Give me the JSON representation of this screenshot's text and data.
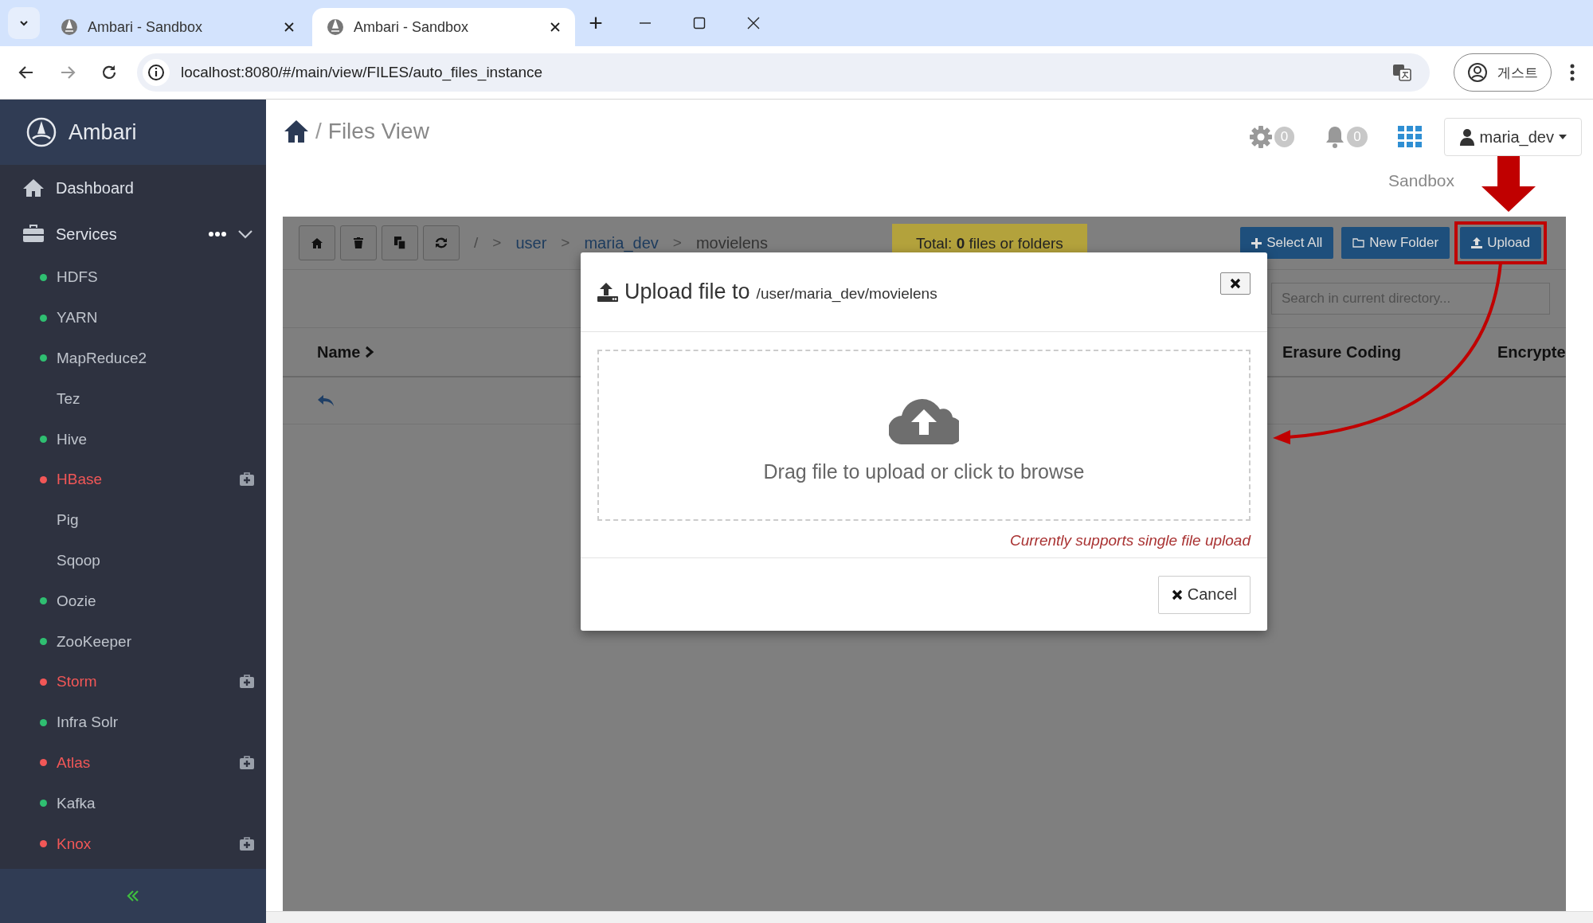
{
  "browser": {
    "tabs": [
      {
        "title": "Ambari - Sandbox",
        "selected": false
      },
      {
        "title": "Ambari - Sandbox",
        "selected": true
      }
    ],
    "new_tab": "+",
    "url": "localhost:8080/#/main/view/FILES/auto_files_instance",
    "profile": "게스트"
  },
  "sidebar": {
    "brand": "Ambari",
    "dashboard": "Dashboard",
    "services": {
      "label": "Services",
      "expanded": true,
      "items": [
        {
          "name": "HDFS",
          "color": "#2fbf71",
          "critical": false
        },
        {
          "name": "YARN",
          "color": "#2fbf71",
          "critical": false
        },
        {
          "name": "MapReduce2",
          "color": "#2fbf71",
          "critical": false
        },
        {
          "name": "Tez",
          "critical": false
        },
        {
          "name": "Hive",
          "color": "#2fbf71",
          "critical": false
        },
        {
          "name": "HBase",
          "color": "#f25757",
          "critical": true
        },
        {
          "name": "Pig",
          "critical": false
        },
        {
          "name": "Sqoop",
          "critical": false
        },
        {
          "name": "Oozie",
          "color": "#2fbf71",
          "critical": false
        },
        {
          "name": "ZooKeeper",
          "color": "#2fbf71",
          "critical": false
        },
        {
          "name": "Storm",
          "color": "#f25757",
          "critical": true
        },
        {
          "name": "Infra Solr",
          "color": "#2fbf71",
          "critical": false
        },
        {
          "name": "Atlas",
          "color": "#f25757",
          "critical": true
        },
        {
          "name": "Kafka",
          "color": "#2fbf71",
          "critical": false
        },
        {
          "name": "Knox",
          "color": "#f25757",
          "critical": true
        }
      ]
    }
  },
  "header": {
    "separator": "/",
    "title": "Files View",
    "settings_count": "0",
    "alerts_count": "0",
    "user": "maria_dev",
    "cluster": "Sandbox"
  },
  "toolbar": {
    "root": "/",
    "breadcrumb": [
      {
        "sep": ">",
        "label": "user",
        "link": true
      },
      {
        "sep": ">",
        "label": "maria_dev",
        "link": true
      },
      {
        "sep": ">",
        "label": "movielens",
        "link": false
      }
    ],
    "total": "Total: **0** files or folders",
    "actions": [
      {
        "label": "Select All",
        "kind": "select",
        "annotated": false
      },
      {
        "label": "New Folder",
        "kind": "folder",
        "annotated": false
      },
      {
        "label": "Upload",
        "kind": "upload",
        "annotated": true
      }
    ],
    "search": {
      "placeholder": "Search in current directory..."
    }
  },
  "table": {
    "columns": [
      {
        "label": "Name",
        "sortable": true
      },
      {
        "label": "Erasure Coding",
        "sortable": false
      },
      {
        "label": "Encrypte",
        "sortable": false
      }
    ]
  },
  "modal": {
    "title": "Upload file to",
    "path": "/user/maria_dev/movielens",
    "dropzone": "Drag file to upload or click to browse",
    "note": "Currently supports single file upload",
    "cancel": "Cancel"
  }
}
